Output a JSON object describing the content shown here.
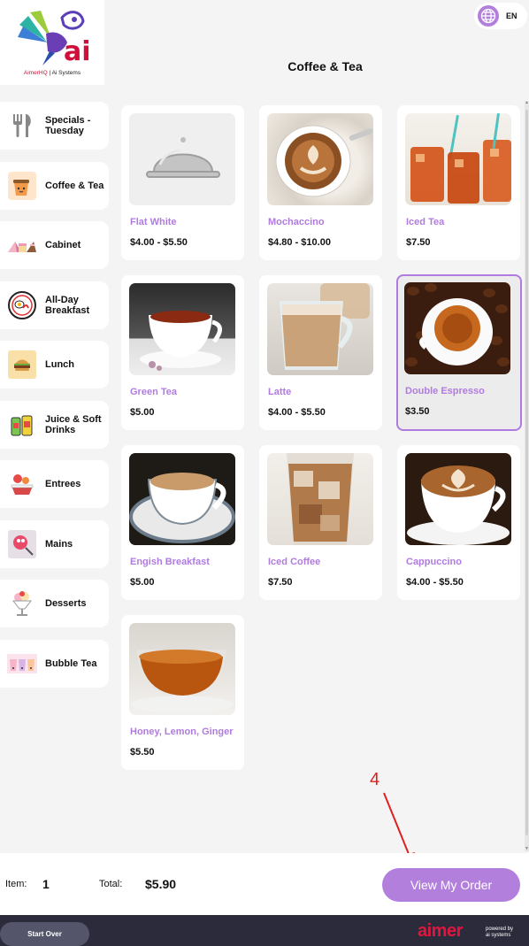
{
  "header": {
    "logo_caption_brand": "AimerHQ",
    "logo_caption_rest": " | Ai Systems",
    "logo_mark_text": "ai",
    "language": "EN",
    "page_title": "Coffee & Tea"
  },
  "sidebar": {
    "items": [
      {
        "label": "Specials -\nTuesday",
        "icon": "cutlery-icon"
      },
      {
        "label": "Coffee & Tea",
        "icon": "coffee-cup-icon"
      },
      {
        "label": "Cabinet",
        "icon": "cakes-icon"
      },
      {
        "label": "All-Day\nBreakfast",
        "icon": "breakfast-plate-icon"
      },
      {
        "label": "Lunch",
        "icon": "burger-icon"
      },
      {
        "label": "Juice & Soft\nDrinks",
        "icon": "juice-cans-icon"
      },
      {
        "label": "Entrees",
        "icon": "entree-bowl-icon"
      },
      {
        "label": "Mains",
        "icon": "mains-dish-icon"
      },
      {
        "label": "Desserts",
        "icon": "sundae-icon"
      },
      {
        "label": "Bubble Tea",
        "icon": "bubble-tea-icon"
      }
    ]
  },
  "products": [
    {
      "name": "Flat White",
      "price": "$4.00 - $5.50",
      "image": "cloche-placeholder-icon"
    },
    {
      "name": "Mochaccino",
      "price": "$4.80 - $10.00",
      "image": "mochaccino-photo"
    },
    {
      "name": "Iced Tea",
      "price": "$7.50",
      "image": "iced-tea-photo"
    },
    {
      "name": "Green Tea",
      "price": "$5.00",
      "image": "green-tea-photo"
    },
    {
      "name": "Latte",
      "price": "$4.00 - $5.50",
      "image": "latte-photo"
    },
    {
      "name": "Double Espresso",
      "price": "$3.50",
      "image": "double-espresso-photo",
      "selected": true
    },
    {
      "name": "Engish Breakfast",
      "price": "$5.00",
      "image": "english-breakfast-photo"
    },
    {
      "name": "Iced Coffee",
      "price": "$7.50",
      "image": "iced-coffee-photo"
    },
    {
      "name": "Cappuccino",
      "price": "$4.00 - $5.50",
      "image": "cappuccino-photo"
    },
    {
      "name": "Honey, Lemon, Ginger",
      "price": "$5.50",
      "image": "honey-lemon-ginger-photo"
    }
  ],
  "annotation": {
    "number": "4"
  },
  "order": {
    "item_label": "Item:",
    "item_count": "1",
    "total_label": "Total:",
    "total_value": "$5.90",
    "view_button": "View My Order"
  },
  "footer": {
    "start_over": "Start Over",
    "brand": "aimer",
    "powered_by": "powered by\nai systems"
  },
  "colors": {
    "accent": "#b27fdd",
    "product_name": "#b07be0",
    "brand_red": "#e0163f",
    "footer_bg": "#2b2b3b"
  }
}
